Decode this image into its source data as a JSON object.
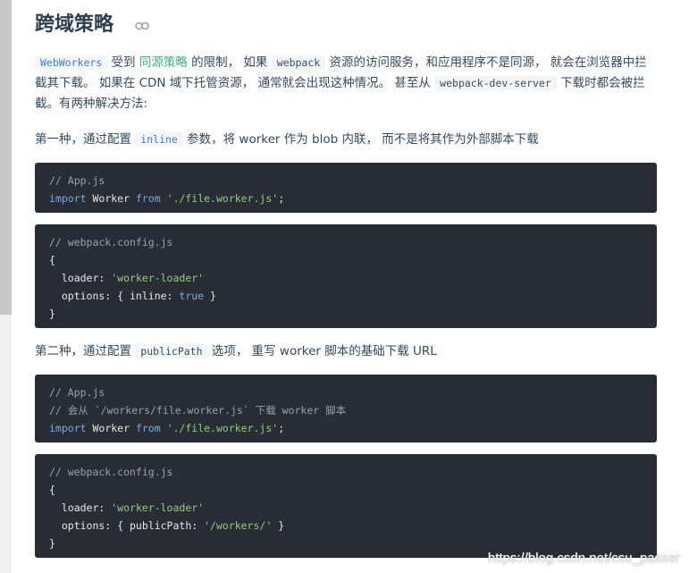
{
  "heading": {
    "title": "跨域策略"
  },
  "intro": {
    "p1_code": "WebWorkers",
    "p1_t1": " 受到 ",
    "p1_link": "同源策略",
    "p1_t2": " 的限制， 如果 ",
    "p1_code2": "webpack",
    "p1_t3": " 资源的访问服务，和应用程序不是同源， 就会在浏览器中拦截其下载。 如果在 CDN 域下托管资源， 通常就会出现这种情况。 甚至从 ",
    "p1_code3": "webpack-dev-server",
    "p1_t4": " 下载时都会被拦截。有两种解决方法:"
  },
  "way1": {
    "t1": "第一种，通过配置 ",
    "code": "inline",
    "t2": " 参数，将 worker 作为 blob 内联， 而不是将其作为外部脚本下载"
  },
  "way2": {
    "t1": "第二种，通过配置 ",
    "code": "publicPath",
    "t2": " 选项， 重写 worker 脚本的基础下载 URL"
  },
  "code1": {
    "l1": "// App.js",
    "l2_kw": "import",
    "l2_a": " Worker ",
    "l2_kw2": "from",
    "l2_sp": " ",
    "l2_str": "'./file.worker.js'",
    "l2_end": ";"
  },
  "code2": {
    "l1": "// webpack.config.js",
    "l2": "{",
    "l3_a": "  loader: ",
    "l3_str": "'worker-loader'",
    "l4_a": "  options: { inline: ",
    "l4_kw": "true",
    "l4_b": " }",
    "l5": "}"
  },
  "code3": {
    "l1": "// App.js",
    "l2": "// 会从 `/workers/file.worker.js` 下载 worker 脚本",
    "l3_kw": "import",
    "l3_a": " Worker ",
    "l3_kw2": "from",
    "l3_sp": " ",
    "l3_str": "'./file.worker.js'",
    "l3_end": ";"
  },
  "code4": {
    "l1": "// webpack.config.js",
    "l2": "{",
    "l3_a": "  loader: ",
    "l3_str": "'worker-loader'",
    "l4_a": "  options: { publicPath: ",
    "l4_str": "'/workers/'",
    "l4_b": " }",
    "l5": "}"
  },
  "watermark": "https://blog.csdn.net/csu_passer",
  "icons": {
    "anchor": "link-icon"
  },
  "colors": {
    "link": "#3eaf7c",
    "code_bg": "#282c34",
    "heading": "#2c3e50"
  }
}
